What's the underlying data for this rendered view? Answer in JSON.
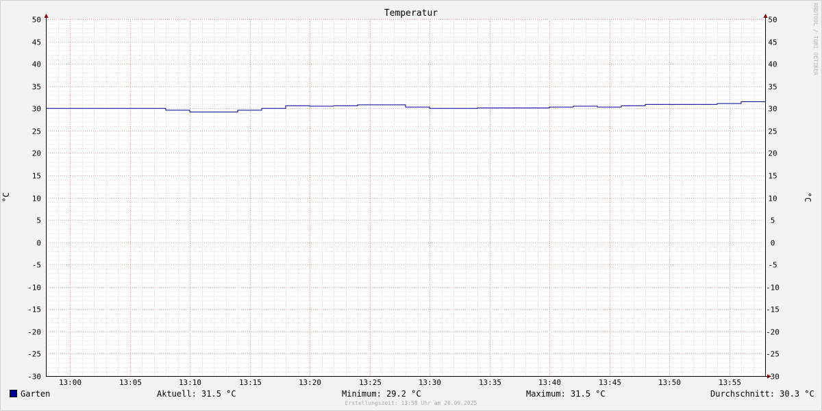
{
  "watermark": "RRDTOOL / TOBI OETIKER",
  "legend": {
    "series_name": "Garten",
    "series_color": "#000099",
    "current": "Aktuell: 31.5 °C",
    "minimum": "Minimum: 29.2 °C",
    "maximum": "Maximum: 31.5 °C",
    "average": "Durchschnitt: 30.3 °C"
  },
  "footer": "Erstellungszeit: 13:58 Uhr am 20.09.2025",
  "chart_data": {
    "type": "line",
    "title": "Temperatur",
    "ylabel": "°C",
    "ylabel_right": "°C",
    "xlabel": "",
    "ylim": [
      -30,
      50
    ],
    "xlim_minutes": [
      "12:58",
      "13:58"
    ],
    "yticks": [
      50,
      45,
      40,
      35,
      30,
      25,
      20,
      15,
      10,
      5,
      0,
      -5,
      -10,
      -15,
      -20,
      -25,
      -30
    ],
    "xticks": [
      "13:00",
      "13:05",
      "13:10",
      "13:15",
      "13:20",
      "13:25",
      "13:30",
      "13:35",
      "13:40",
      "13:45",
      "13:50",
      "13:55"
    ],
    "grid": true,
    "series": [
      {
        "name": "Garten",
        "color": "#000099",
        "step": true,
        "points": [
          [
            "12:58",
            30.0
          ],
          [
            "13:08",
            29.6
          ],
          [
            "13:10",
            29.2
          ],
          [
            "13:14",
            29.6
          ],
          [
            "13:16",
            30.0
          ],
          [
            "13:18",
            30.6
          ],
          [
            "13:20",
            30.5
          ],
          [
            "13:22",
            30.6
          ],
          [
            "13:24",
            30.8
          ],
          [
            "13:28",
            30.3
          ],
          [
            "13:30",
            30.0
          ],
          [
            "13:34",
            30.1
          ],
          [
            "13:40",
            30.3
          ],
          [
            "13:42",
            30.5
          ],
          [
            "13:44",
            30.3
          ],
          [
            "13:46",
            30.6
          ],
          [
            "13:48",
            30.9
          ],
          [
            "13:54",
            31.1
          ],
          [
            "13:56",
            31.5
          ],
          [
            "13:58",
            31.5
          ]
        ]
      }
    ]
  }
}
